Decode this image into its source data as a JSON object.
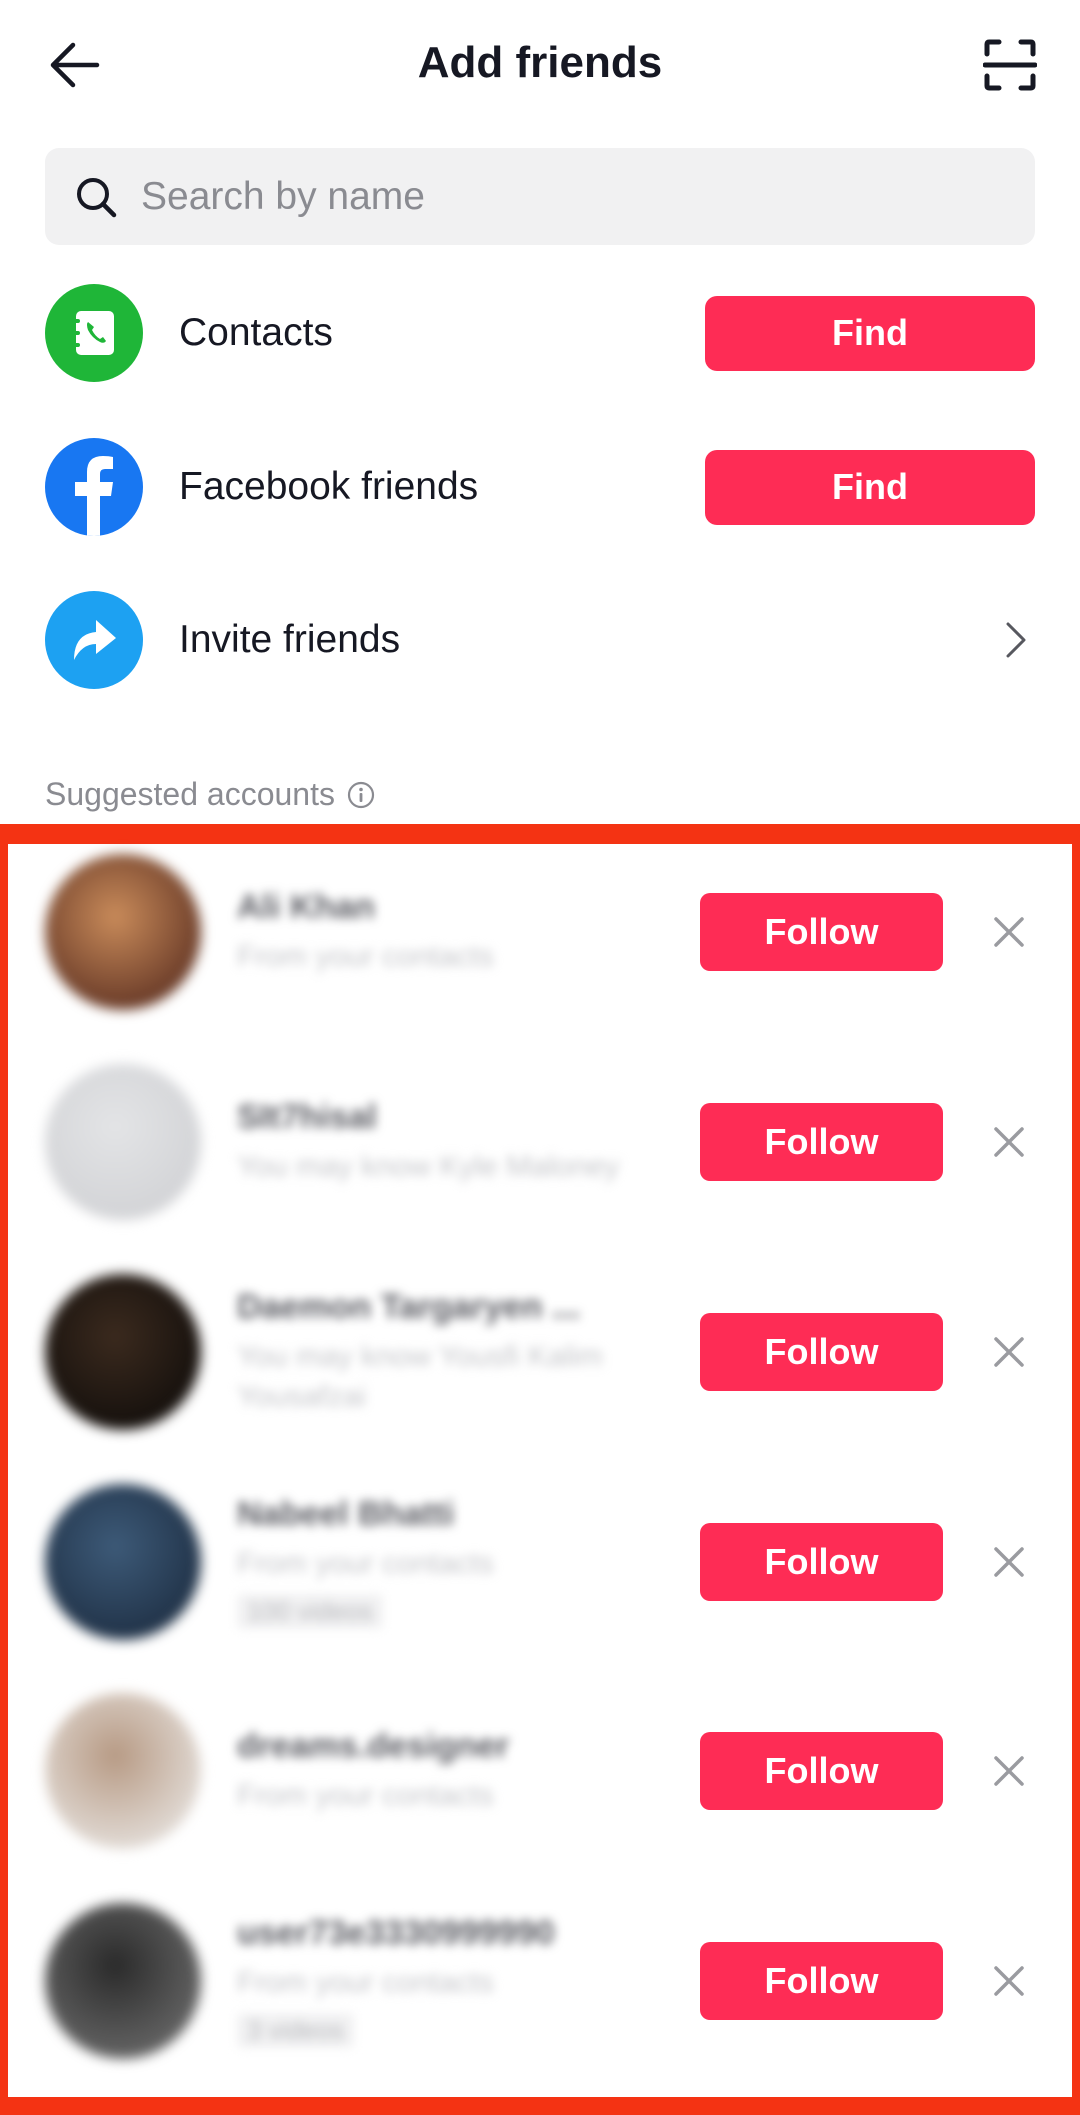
{
  "header": {
    "title": "Add friends",
    "back_icon": "arrow-left-icon",
    "scan_icon": "scan-qr-icon"
  },
  "search": {
    "placeholder": "Search by name",
    "value": "",
    "icon": "search-icon"
  },
  "options": [
    {
      "label": "Contacts",
      "icon": "contacts-book-icon",
      "icon_color": "#1fb638",
      "action_label": "Find"
    },
    {
      "label": "Facebook friends",
      "icon": "facebook-icon",
      "icon_color": "#1877f2",
      "action_label": "Find"
    },
    {
      "label": "Invite friends",
      "icon": "share-arrow-icon",
      "icon_color": "#1da1f2",
      "action": "chevron-right-icon"
    }
  ],
  "suggested": {
    "label": "Suggested accounts",
    "info_icon": "info-icon",
    "accounts": [
      {
        "name": "Ali Khan",
        "subtitle": "From your contacts",
        "badge": "",
        "avatar_colors": [
          "#c98b5a",
          "#5a2e20"
        ],
        "follow_label": "Follow"
      },
      {
        "name": "SIt7hisal",
        "subtitle": "You may know Kyle Maloney",
        "badge": "",
        "avatar_colors": [
          "#e3e4e6",
          "#d0d1d4"
        ],
        "follow_label": "Follow"
      },
      {
        "name": "Daemon Targaryen ...",
        "subtitle": "You may know Yousfi Kalim Yousafzai",
        "badge": "",
        "avatar_colors": [
          "#3b2a1e",
          "#0f0c0a"
        ],
        "follow_label": "Follow"
      },
      {
        "name": "Nabeel Bhatti",
        "subtitle": "From your contacts",
        "badge": "100 videos",
        "avatar_colors": [
          "#3d5a78",
          "#1c2c40"
        ],
        "follow_label": "Follow"
      },
      {
        "name": "dreams.designer",
        "subtitle": "From your contacts",
        "badge": "",
        "avatar_colors": [
          "#b79a84",
          "#e8e5e2"
        ],
        "follow_label": "Follow"
      },
      {
        "name": "user73e3330999990",
        "subtitle": "From your contacts",
        "badge": "3 videos",
        "avatar_colors": [
          "#2a2a2a",
          "#6d6d6d"
        ],
        "follow_label": "Follow"
      }
    ],
    "dismiss_icon": "close-icon"
  },
  "colors": {
    "accent": "#fe2c55",
    "highlight_border": "#f43313",
    "search_bg": "#f1f1f2",
    "secondary_text": "#8a8b91"
  }
}
